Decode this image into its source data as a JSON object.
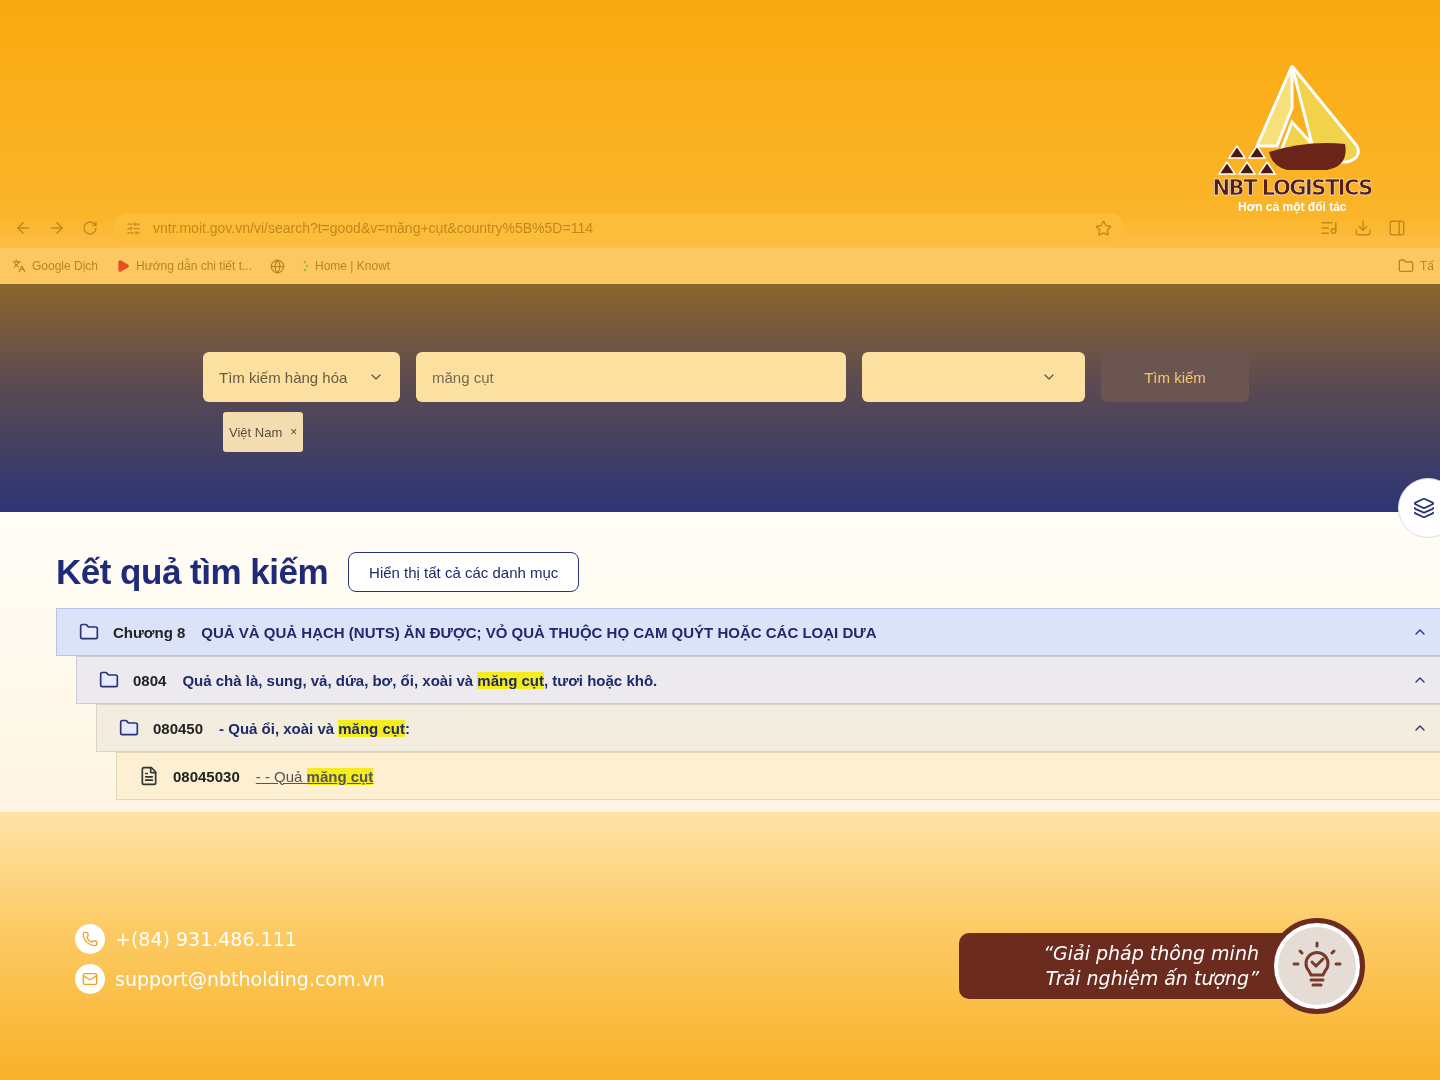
{
  "browser": {
    "url": "vntr.moit.gov.vn/vi/search?t=good&v=măng+cụt&country%5B%5D=114",
    "bookmarks": [
      {
        "kind": "translate",
        "label": "Google Dịch"
      },
      {
        "kind": "video",
        "label": "Hướng dẫn chi tiết t..."
      },
      {
        "kind": "globe"
      },
      {
        "kind": "knowt",
        "label": "Home | Knowt"
      }
    ],
    "bookmarks_folder": "Tấ"
  },
  "brand": {
    "name": "NBT LOGISTICS",
    "tagline": "Hơn cả một đối tác"
  },
  "search": {
    "type_select": "Tìm kiếm hàng hóa",
    "query": "măng cụt",
    "button": "Tìm kiếm",
    "tags": [
      {
        "label": "Việt Nam",
        "remove": "×"
      }
    ]
  },
  "results": {
    "title": "Kết quả tìm kiếm",
    "show_all_button": "Hiển thị tất cả các danh mục",
    "tree": [
      {
        "kind": "folder",
        "code": "Chương 8",
        "title": "QUẢ VÀ QUẢ HẠCH (NUTS) ĂN ĐƯỢC; VỎ QUẢ THUỘC HỌ CAM QUÝT HOẶC CÁC LOẠI DƯA",
        "expanded": true,
        "children": [
          {
            "kind": "folder",
            "code": "0804",
            "title": "Quả chà là, sung, vả, dứa, bơ, ổi, xoài và **măng cụt**, tươi hoặc khô.",
            "expanded": true,
            "children": [
              {
                "kind": "folder",
                "code": "080450",
                "title": "- Quả ổi, xoài và **măng cụt**:",
                "expanded": true,
                "children": [
                  {
                    "kind": "document",
                    "code": "08045030",
                    "title": "- - Quả **măng cụt**"
                  }
                ]
              }
            ]
          }
        ]
      }
    ]
  },
  "contact": {
    "phone": "+(84) 931.486.111",
    "email": "support@nbtholding.com.vn"
  },
  "slogan": [
    "“Giải pháp thông minh",
    "Trải nghiệm ấn tượng”"
  ]
}
